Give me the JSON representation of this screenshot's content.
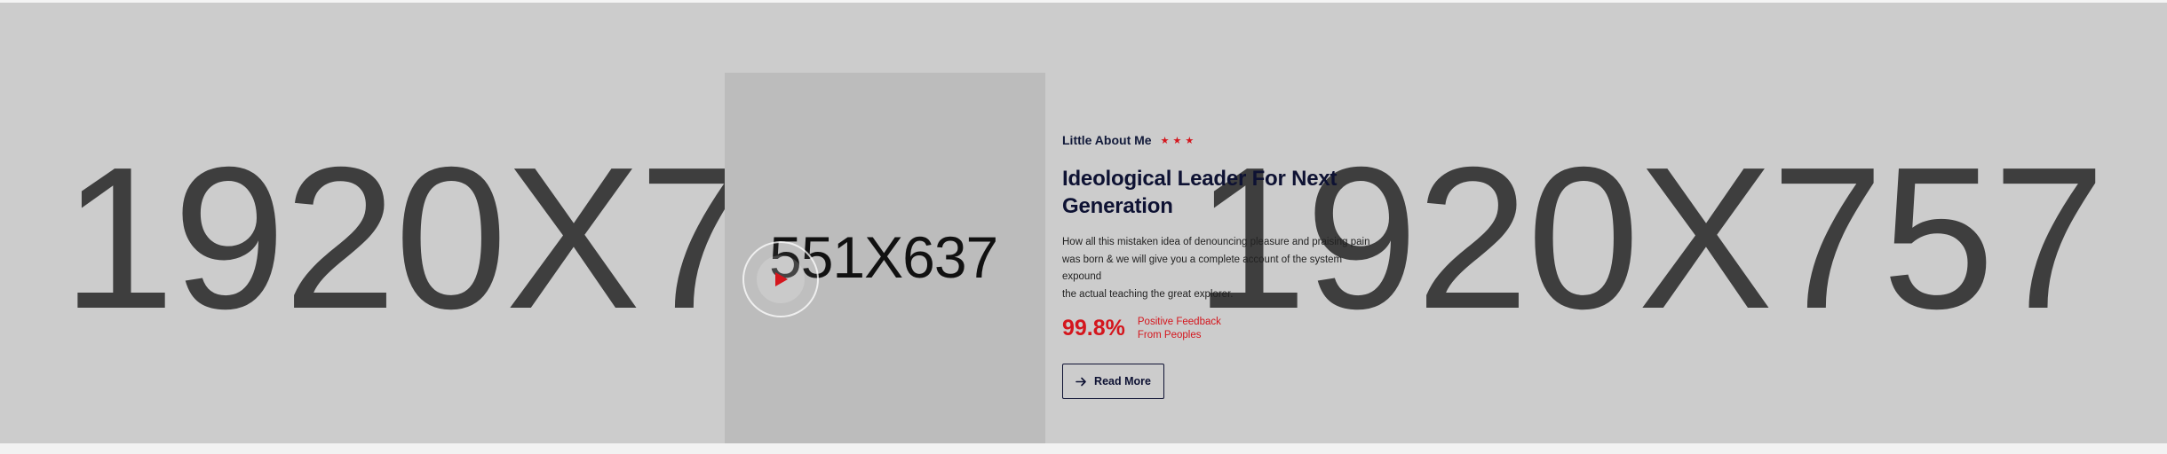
{
  "background": {
    "placeholder_left": "1920X7",
    "placeholder_right": "1920X757"
  },
  "photo": {
    "placeholder": "551X637"
  },
  "about": {
    "subtitle": "Little About Me",
    "title_line1": "Ideological Leader For Next",
    "title_line2": "Generation",
    "description_line1": "How all this mistaken idea of denouncing pleasure and praising pain",
    "description_line2": "was born & we will give you a complete account of the system expound",
    "description_line3": "the actual teaching the great explorer.",
    "stat_value": "99.8%",
    "stat_label_line1": "Positive Feedback",
    "stat_label_line2": "From Peoples",
    "button_label": "Read More"
  },
  "icons": {
    "star": "star-icon",
    "play": "play-icon",
    "arrow": "arrow-right-icon"
  },
  "colors": {
    "accent": "#d4161d",
    "heading": "#0e1233",
    "placeholder_bg": "#cccccc",
    "photo_bg": "#bcbcbc"
  }
}
